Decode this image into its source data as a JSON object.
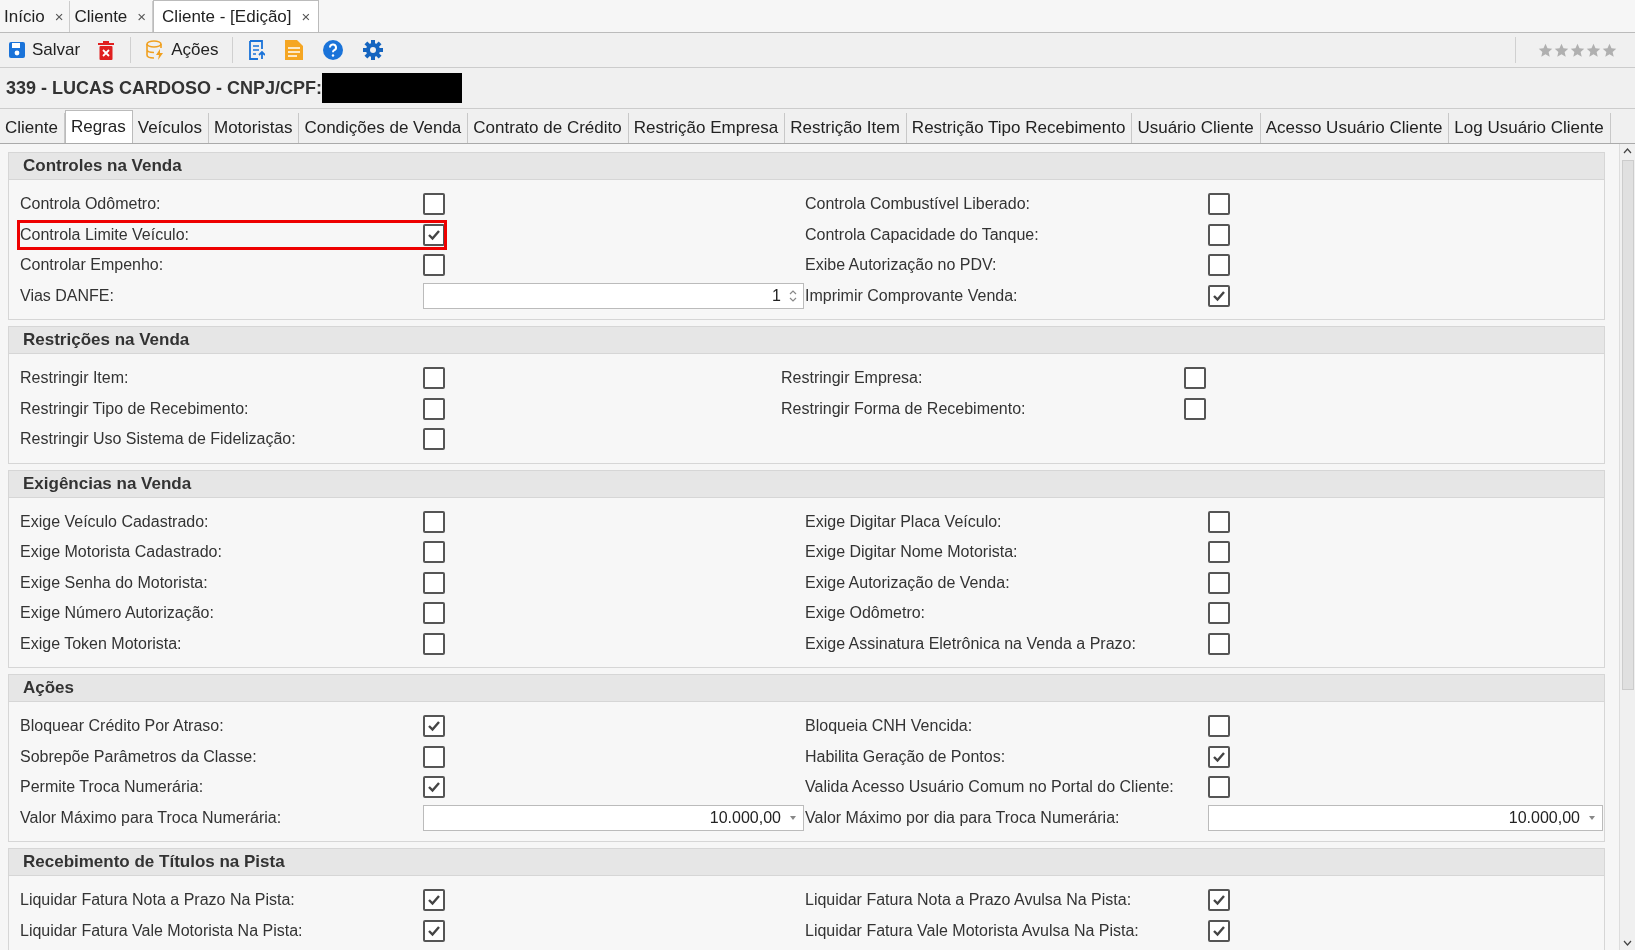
{
  "doc_tabs": [
    {
      "label": "Início",
      "selected": false,
      "close": "×"
    },
    {
      "label": "Cliente",
      "selected": false,
      "close": "×"
    },
    {
      "label": "Cliente - [Edição]",
      "selected": true,
      "close": "×"
    }
  ],
  "toolbar": {
    "save": "Salvar",
    "actions": "Ações",
    "stars": 0
  },
  "record_title": "339 - LUCAS CARDOSO - CNPJ/CPF:",
  "tabs": [
    {
      "label": "Cliente",
      "selected": false
    },
    {
      "label": "Regras",
      "selected": true
    },
    {
      "label": "Veículos",
      "selected": false
    },
    {
      "label": "Motoristas",
      "selected": false
    },
    {
      "label": "Condições de Venda",
      "selected": false
    },
    {
      "label": "Contrato de Crédito",
      "selected": false
    },
    {
      "label": "Restrição Empresa",
      "selected": false
    },
    {
      "label": "Restrição Item",
      "selected": false
    },
    {
      "label": "Restrição Tipo Recebimento",
      "selected": false
    },
    {
      "label": "Usuário Cliente",
      "selected": false
    },
    {
      "label": "Acesso Usuário Cliente",
      "selected": false
    },
    {
      "label": "Log Usuário Cliente",
      "selected": false
    }
  ],
  "sections": [
    {
      "title": "Controles na Venda",
      "left": [
        {
          "kind": "checkbox",
          "label": "Controla Odômetro:",
          "checked": false,
          "highlighted": false
        },
        {
          "kind": "checkbox",
          "label": "Controla Limite Veículo:",
          "checked": true,
          "highlighted": true
        },
        {
          "kind": "checkbox",
          "label": "Controlar Empenho:",
          "checked": false,
          "highlighted": false
        },
        {
          "kind": "spin",
          "label": "Vias DANFE:",
          "value": "1"
        }
      ],
      "right": [
        {
          "kind": "checkbox",
          "label": "Controla Combustível Liberado:",
          "checked": false,
          "highlighted": false
        },
        {
          "kind": "checkbox",
          "label": "Controla Capacidade do Tanque:",
          "checked": false,
          "highlighted": false
        },
        {
          "kind": "checkbox",
          "label": "Exibe Autorização no PDV:",
          "checked": false,
          "highlighted": false
        },
        {
          "kind": "checkbox",
          "label": "Imprimir Comprovante Venda:",
          "checked": true,
          "highlighted": false
        }
      ]
    },
    {
      "title": "Restrições na Venda",
      "left": [
        {
          "kind": "checkbox",
          "label": "Restringir Item:",
          "checked": false,
          "highlighted": false
        },
        {
          "kind": "checkbox",
          "label": "Restringir Tipo de Recebimento:",
          "checked": false,
          "highlighted": false
        },
        {
          "kind": "checkbox",
          "label": "Restringir Uso Sistema de Fidelização:",
          "checked": false,
          "highlighted": false
        }
      ],
      "right": [
        {
          "kind": "checkbox",
          "label": "Restringir Empresa:",
          "checked": false,
          "highlighted": false
        },
        {
          "kind": "checkbox",
          "label": "Restringir Forma de Recebimento:",
          "checked": false,
          "highlighted": false
        }
      ]
    },
    {
      "title": "Exigências na Venda",
      "left": [
        {
          "kind": "checkbox",
          "label": "Exige Veículo Cadastrado:",
          "checked": false,
          "highlighted": false
        },
        {
          "kind": "checkbox",
          "label": "Exige Motorista Cadastrado:",
          "checked": false,
          "highlighted": false
        },
        {
          "kind": "checkbox",
          "label": "Exige Senha do Motorista:",
          "checked": false,
          "highlighted": false
        },
        {
          "kind": "checkbox",
          "label": "Exige Número Autorização:",
          "checked": false,
          "highlighted": false
        },
        {
          "kind": "checkbox",
          "label": "Exige Token Motorista:",
          "checked": false,
          "highlighted": false
        }
      ],
      "right": [
        {
          "kind": "checkbox",
          "label": "Exige Digitar Placa Veículo:",
          "checked": false,
          "highlighted": false
        },
        {
          "kind": "checkbox",
          "label": "Exige Digitar Nome Motorista:",
          "checked": false,
          "highlighted": false
        },
        {
          "kind": "checkbox",
          "label": "Exige Autorização de Venda:",
          "checked": false,
          "highlighted": false
        },
        {
          "kind": "checkbox",
          "label": "Exige Odômetro:",
          "checked": false,
          "highlighted": false
        },
        {
          "kind": "checkbox",
          "label": "Exige Assinatura Eletrônica na Venda a Prazo:",
          "checked": false,
          "highlighted": false
        }
      ]
    },
    {
      "title": "Ações",
      "left": [
        {
          "kind": "checkbox",
          "label": "Bloquear Crédito Por Atraso:",
          "checked": true,
          "highlighted": false
        },
        {
          "kind": "checkbox",
          "label": "Sobrepõe Parâmetros da Classe:",
          "checked": false,
          "highlighted": false
        },
        {
          "kind": "checkbox",
          "label": "Permite Troca Numerária:",
          "checked": true,
          "highlighted": false
        },
        {
          "kind": "dropdown",
          "label": "Valor Máximo para Troca Numerária:",
          "value": "10.000,00"
        }
      ],
      "right": [
        {
          "kind": "checkbox",
          "label": "Bloqueia CNH Vencida:",
          "checked": false,
          "highlighted": false
        },
        {
          "kind": "checkbox",
          "label": "Habilita Geração de Pontos:",
          "checked": true,
          "highlighted": false
        },
        {
          "kind": "checkbox",
          "label": "Valida Acesso Usuário Comum no Portal do Cliente:",
          "checked": false,
          "highlighted": false
        },
        {
          "kind": "dropdown",
          "label": "Valor Máximo por dia para Troca Numerária:",
          "value": "10.000,00"
        }
      ]
    },
    {
      "title": "Recebimento de Títulos na Pista",
      "left": [
        {
          "kind": "checkbox",
          "label": "Liquidar Fatura Nota a Prazo Na Pista:",
          "checked": true,
          "highlighted": false
        },
        {
          "kind": "checkbox",
          "label": "Liquidar Fatura Vale Motorista Na Pista:",
          "checked": true,
          "highlighted": false
        }
      ],
      "right": [
        {
          "kind": "checkbox",
          "label": "Liquidar Fatura Nota a Prazo Avulsa Na Pista:",
          "checked": true,
          "highlighted": false
        },
        {
          "kind": "checkbox",
          "label": "Liquidar Fatura Vale Motorista Avulsa Na Pista:",
          "checked": true,
          "highlighted": false
        }
      ]
    }
  ]
}
